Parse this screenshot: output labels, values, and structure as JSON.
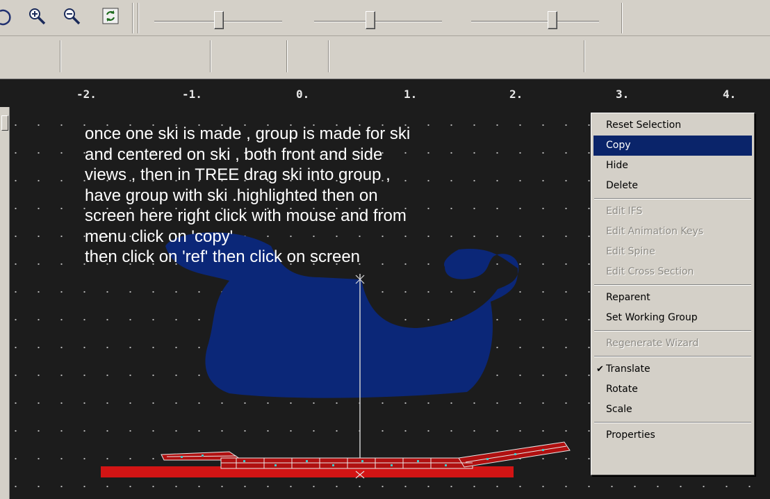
{
  "ruler": {
    "labels": [
      "-2.",
      "-1.",
      "0.",
      "1.",
      "2.",
      "3.",
      "4."
    ]
  },
  "note": {
    "lines": [
      "once one ski is made , group is made for ski",
      "and centered on ski , both front and side",
      "views , then in TREE drag ski into group ,",
      "have group with ski .highlighted then on",
      "screen here right click with mouse and from",
      "menu click on 'copy'",
      "then click on 'ref' then click on screen"
    ]
  },
  "context_menu": {
    "items": [
      {
        "label": "Reset Selection",
        "state": "normal"
      },
      {
        "label": "Copy",
        "state": "highlighted"
      },
      {
        "label": "Hide",
        "state": "normal"
      },
      {
        "label": "Delete",
        "state": "normal"
      },
      {
        "label": "Edit IFS",
        "state": "disabled"
      },
      {
        "label": "Edit Animation Keys",
        "state": "disabled"
      },
      {
        "label": "Edit Spine",
        "state": "disabled"
      },
      {
        "label": "Edit Cross Section",
        "state": "disabled"
      },
      {
        "label": "Reparent",
        "state": "normal"
      },
      {
        "label": "Set Working Group",
        "state": "normal"
      },
      {
        "label": "Regenerate Wizard",
        "state": "disabled"
      },
      {
        "label": "Translate",
        "state": "checked"
      },
      {
        "label": "Rotate",
        "state": "normal"
      },
      {
        "label": "Scale",
        "state": "normal"
      },
      {
        "label": "Properties",
        "state": "normal"
      }
    ],
    "check_glyph": "✔"
  },
  "toolbar_top": {
    "icons": [
      "rotate-icon",
      "zoom-in-icon",
      "zoom-out-icon",
      "fit-view-icon"
    ]
  },
  "toolbar_shapes": {
    "icons": [
      "cone-icon",
      "sphere-icon",
      "box-icon",
      "extrusion-icon",
      "ifs-icon",
      "vase-icon",
      "ref-icon",
      "group-icon",
      "disabled-shape-icon",
      "light-icon",
      "camera-icon",
      "background-icon",
      "sound-icon",
      "fog-icon",
      "navigation-icon",
      "text-icon",
      "animation-icon",
      "world-icon",
      "spider-icon",
      "box-red-icon"
    ]
  },
  "colors": {
    "viewport_bg": "#1c1c1c",
    "shape_blue": "#0b2778",
    "ski_red": "#d21414",
    "menu_highlight": "#0a246a"
  }
}
